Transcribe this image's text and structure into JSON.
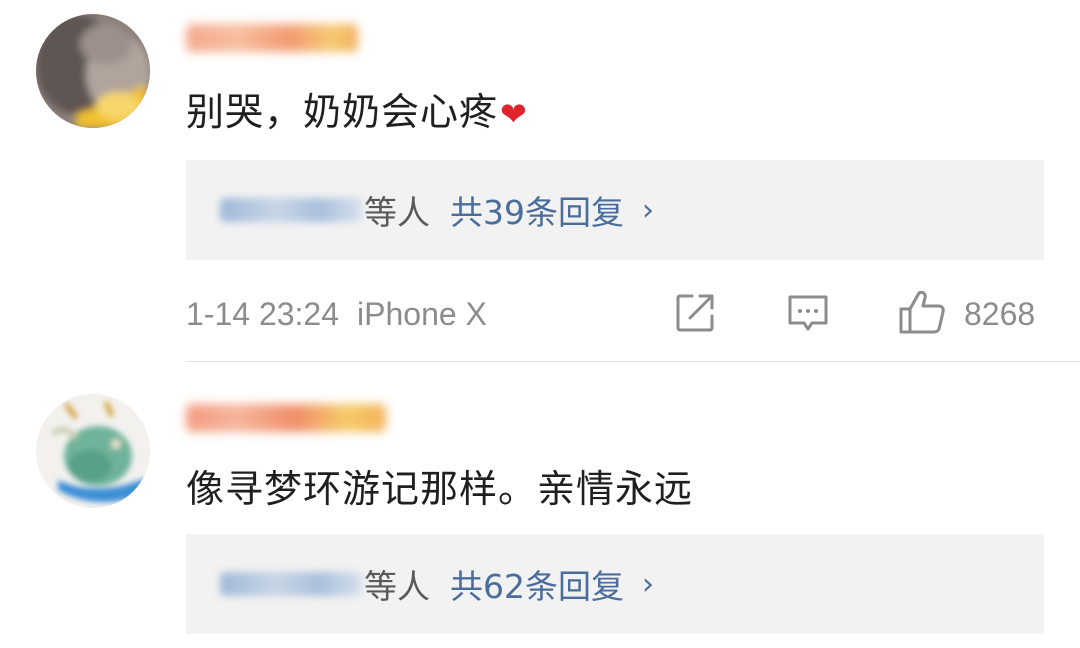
{
  "comments": [
    {
      "text": "别哭，奶奶会心疼",
      "emoji": "❤",
      "reply_names_suffix": "等人",
      "reply_count_label": "共39条回复",
      "reply_chevron": "›",
      "time": "1-14 23:24",
      "device": "iPhone X",
      "likes": "8268"
    },
    {
      "text": "像寻梦环游记那样。亲情永远",
      "reply_names_suffix": "等人",
      "reply_count_label": "共62条回复",
      "reply_chevron": "›"
    }
  ],
  "icons": {
    "share": "share-icon",
    "comment": "comment-icon",
    "like": "thumbs-up-icon"
  },
  "colors": {
    "link_blue": "#4a6d9c",
    "meta_gray": "#8c8c8c",
    "reply_bg": "#f2f2f2",
    "heart_red": "#e0242e"
  }
}
